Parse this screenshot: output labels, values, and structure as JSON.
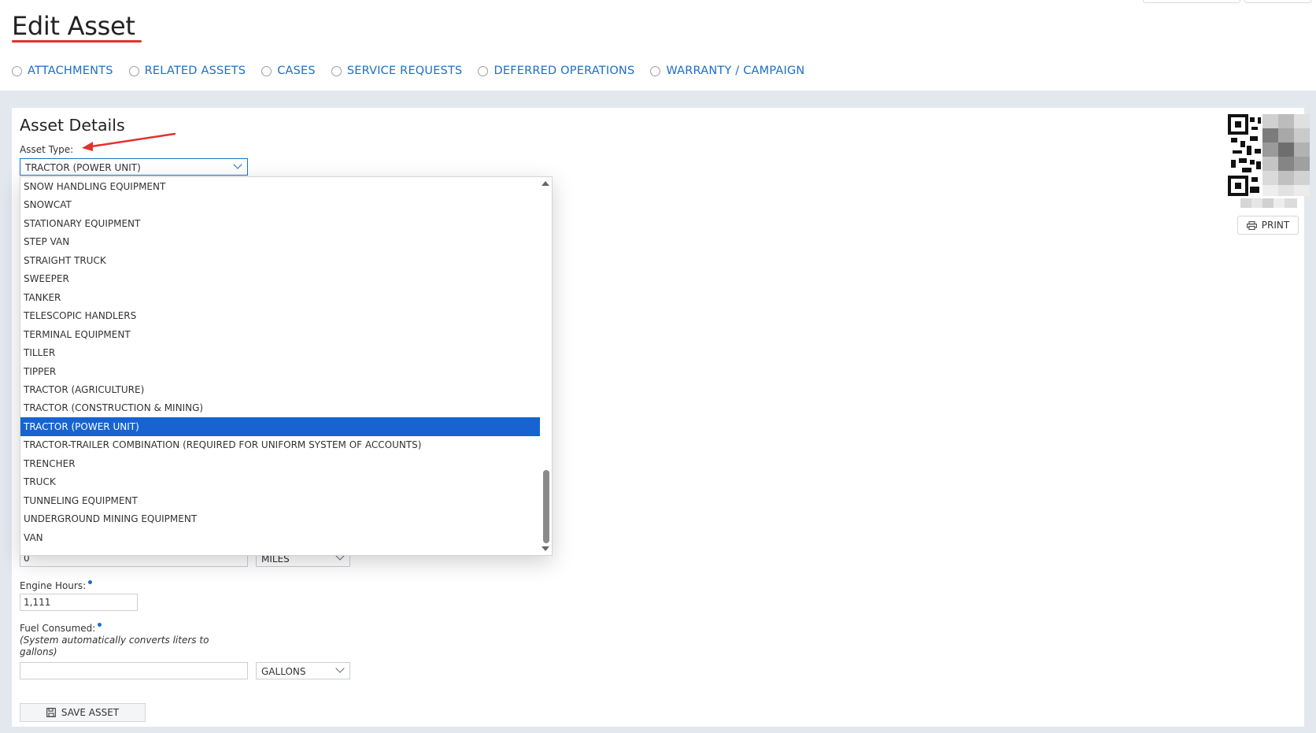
{
  "page": {
    "title": "Edit Asset"
  },
  "tabs": [
    {
      "label": "ATTACHMENTS"
    },
    {
      "label": "RELATED ASSETS"
    },
    {
      "label": "CASES"
    },
    {
      "label": "SERVICE REQUESTS"
    },
    {
      "label": "DEFERRED OPERATIONS"
    },
    {
      "label": "WARRANTY / CAMPAIGN"
    }
  ],
  "details": {
    "section_title": "Asset Details",
    "asset_type_label": "Asset Type:",
    "asset_type_value": "TRACTOR (POWER UNIT)",
    "odometer_value": "0",
    "odometer_unit": "MILES",
    "engine_hours_label": "Engine Hours:",
    "engine_hours_value": "1,111",
    "fuel_label": "Fuel Consumed:",
    "fuel_note": "(System automatically converts liters to gallons)",
    "fuel_value": "",
    "fuel_unit": "GALLONS"
  },
  "dropdown": {
    "options": [
      "SNOW HANDLING EQUIPMENT",
      "SNOWCAT",
      "STATIONARY EQUIPMENT",
      "STEP VAN",
      "STRAIGHT TRUCK",
      "SWEEPER",
      "TANKER",
      "TELESCOPIC HANDLERS",
      "TERMINAL EQUIPMENT",
      "TILLER",
      "TIPPER",
      "TRACTOR (AGRICULTURE)",
      "TRACTOR (CONSTRUCTION & MINING)",
      "TRACTOR (POWER UNIT)",
      "TRACTOR-TRAILER COMBINATION (REQUIRED FOR UNIFORM SYSTEM OF ACCOUNTS)",
      "TRENCHER",
      "TRUCK",
      "TUNNELING EQUIPMENT",
      "UNDERGROUND MINING EQUIPMENT",
      "VAN"
    ],
    "selected_index": 13
  },
  "qr": {
    "print_label": "PRINT"
  },
  "actions": {
    "save_label": "SAVE ASSET"
  },
  "colors": {
    "accent": "#1a6fc9",
    "selected": "#1763d2",
    "underline": "#e0332e",
    "band": "#e3e8ef"
  }
}
